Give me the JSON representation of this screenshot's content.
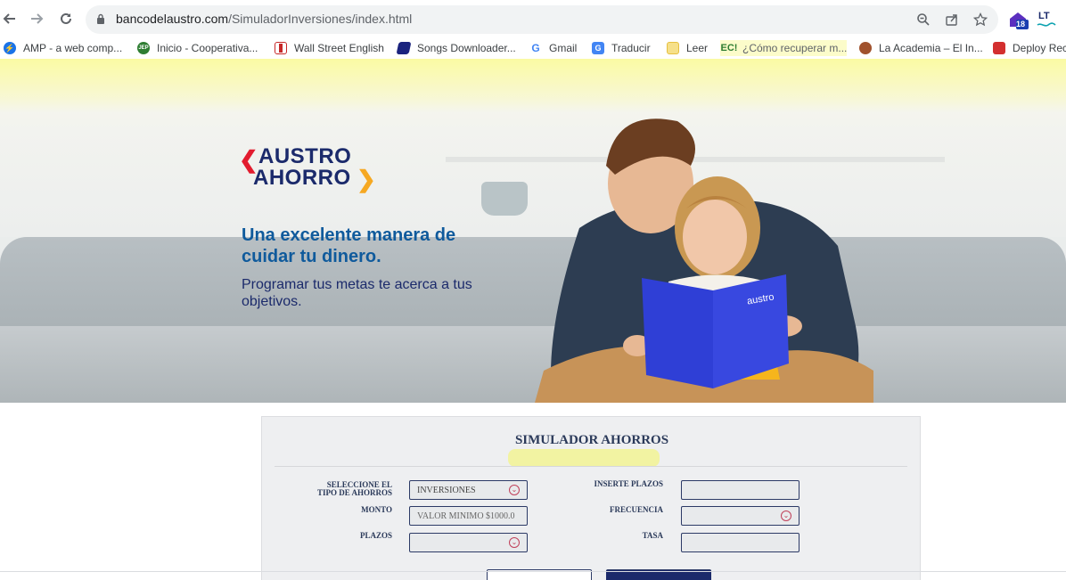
{
  "browser": {
    "url_host": "bancodelaustro.com",
    "url_path": "/SimuladorInversiones/index.html",
    "extension_badge": "18",
    "ext_label": "LT"
  },
  "bookmarks": [
    {
      "label": "AMP - a web comp...",
      "icon": "amp-icon",
      "color": "#1a73e8"
    },
    {
      "label": "Inicio - Cooperativa...",
      "icon": "jep-icon",
      "color": "#2e7d32"
    },
    {
      "label": "Wall Street English",
      "icon": "wse-icon",
      "color": "#c62828"
    },
    {
      "label": "Songs Downloader...",
      "icon": "songs-icon",
      "color": "#1a237e"
    },
    {
      "label": "Gmail",
      "icon": "google-icon",
      "color": "#4285f4"
    },
    {
      "label": "Traducir",
      "icon": "translate-icon",
      "color": "#4285f4"
    },
    {
      "label": "Leer",
      "icon": "bookmark-yellow-icon",
      "color": "#f6d365"
    },
    {
      "label": "¿Cómo recuperar m...",
      "icon": "ec-icon",
      "color": "#ffffff"
    },
    {
      "label": "La Academia – El In...",
      "icon": "academia-icon",
      "color": "#a0522d"
    },
    {
      "label": "Deploy Rec",
      "icon": "deploy-icon",
      "color": "#d32f2f"
    }
  ],
  "hero": {
    "logo_line1": "AUSTRO",
    "logo_line2": "AHORRO",
    "headline": "Una excelente manera de cuidar tu dinero.",
    "subline": "Programar tus metas te acerca a tus objetivos.",
    "book_brand": "austro"
  },
  "simulator": {
    "title": "SIMULADOR AHORROS",
    "labels": {
      "tipo": "SELECCIONE EL\nTIPO DE AHORROS",
      "monto": "MONTO",
      "plazos": "PLAZOS",
      "inserte_plazos": "INSERTE PLAZOS",
      "frecuencia": "FRECUENCIA",
      "tasa": "TASA"
    },
    "tipo_value": "INVERSIONES",
    "monto_placeholder": "VALOR MINIMO $1000.0",
    "plazos_value": "",
    "inserte_plazos_value": "",
    "frecuencia_value": "",
    "tasa_value": ""
  },
  "colors": {
    "brand_navy": "#1b2a6b",
    "brand_blue": "#0f5a9c",
    "brand_red": "#e21c2e",
    "brand_orange": "#f6a821",
    "book_blue": "#2f3fd6"
  }
}
